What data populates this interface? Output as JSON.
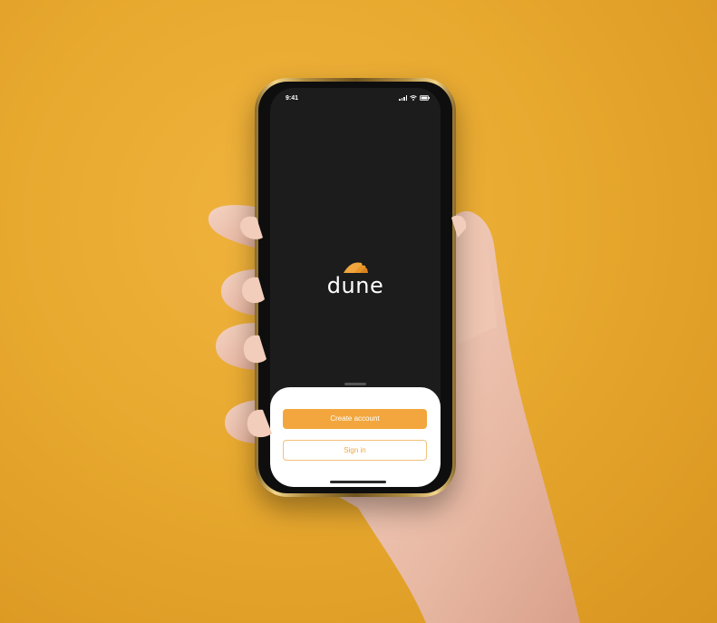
{
  "status_bar": {
    "time": "9:41"
  },
  "app": {
    "name": "dune"
  },
  "actions": {
    "create_account_label": "Create account",
    "sign_in_label": "Sign in"
  },
  "colors": {
    "background": "#e8a92f",
    "accent": "#f2a63d",
    "screen": "#1c1c1c",
    "sheet": "#ffffff"
  },
  "icons": [
    "signal-icon",
    "wifi-icon",
    "battery-icon",
    "dune-logo-icon"
  ]
}
